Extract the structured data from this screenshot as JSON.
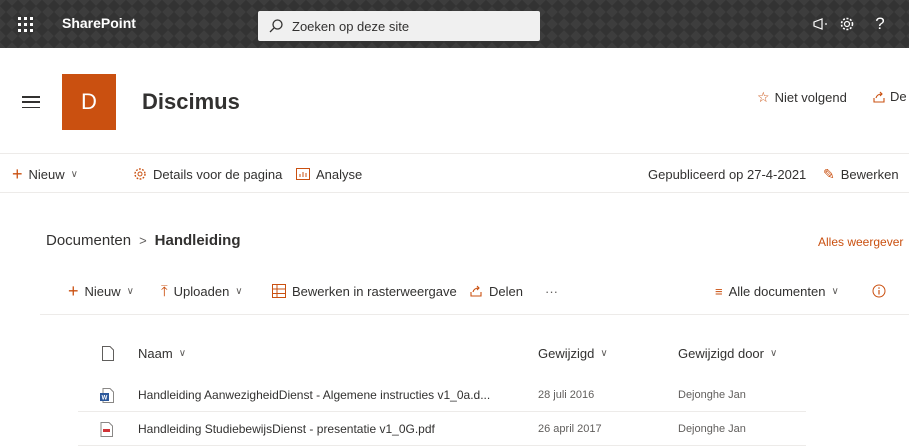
{
  "suite": {
    "brand": "SharePoint",
    "search_placeholder": "Zoeken op deze site"
  },
  "site": {
    "logo_letter": "D",
    "title": "Discimus",
    "follow_label": "Niet volgend",
    "share_label": "De"
  },
  "command_bar": {
    "new_label": "Nieuw",
    "page_details_label": "Details voor de pagina",
    "analytics_label": "Analyse",
    "published_label": "Gepubliceerd op 27-4-2021",
    "edit_label": "Bewerken"
  },
  "breadcrumb": {
    "parent": "Documenten",
    "current": "Handleiding",
    "see_all": "Alles weergever"
  },
  "library_bar": {
    "new_label": "Nieuw",
    "upload_label": "Uploaden",
    "grid_edit_label": "Bewerken in rasterweergave",
    "share_label": "Delen",
    "more_label": "···",
    "view_label": "Alle documenten"
  },
  "table": {
    "columns": {
      "name": "Naam",
      "modified": "Gewijzigd",
      "modified_by": "Gewijzigd door"
    },
    "rows": [
      {
        "icon": "word-file-icon",
        "name": "Handleiding AanwezigheidDienst - Algemene instructies v1_0a.d...",
        "modified": "28 juli 2016",
        "modified_by": "Dejonghe Jan"
      },
      {
        "icon": "pdf-file-icon",
        "name": "Handleiding StudiebewijsDienst - presentatie v1_0G.pdf",
        "modified": "26 april 2017",
        "modified_by": "Dejonghe Jan"
      }
    ]
  },
  "colors": {
    "accent": "#ca5010",
    "suitebar": "#333333",
    "text": "#323130"
  }
}
